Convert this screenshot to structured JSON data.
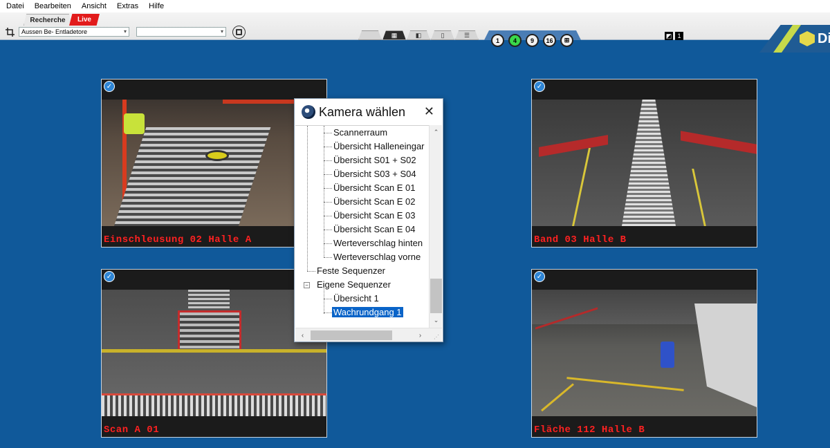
{
  "menu": [
    "Datei",
    "Bearbeiten",
    "Ansicht",
    "Extras",
    "Hilfe"
  ],
  "mode_tabs": {
    "recherche": "Recherche",
    "live": "Live"
  },
  "toolbar": {
    "location_select": "Aussen Be- Entladetore",
    "second_select": "",
    "status_values": [
      "",
      "1"
    ]
  },
  "layout_buttons": [
    {
      "label": "1",
      "active": false
    },
    {
      "label": "4",
      "active": true
    },
    {
      "label": "9",
      "active": false
    },
    {
      "label": "16",
      "active": false
    },
    {
      "label": "⊞",
      "active": false
    }
  ],
  "logo_text": "Di",
  "cameras": [
    {
      "label": "Einschleusung 02 Halle A"
    },
    {
      "label": "Band 03 Halle B"
    },
    {
      "label": "Scan A 01"
    },
    {
      "label": "Fläche 112 Halle B"
    }
  ],
  "dialog": {
    "title": "Kamera wählen",
    "items": [
      "Scannerraum",
      "Übersicht Halleneingar",
      "Übersicht S01 + S02",
      "Übersicht S03 + S04",
      "Übersicht Scan E 01",
      "Übersicht Scan E 02",
      "Übersicht Scan E 03",
      "Übersicht Scan E 04",
      "Werteverschlag hinten",
      "Werteverschlag vorne"
    ],
    "groups": {
      "feste": "Feste Sequenzer",
      "eigene": "Eigene Sequenzer"
    },
    "sub_items": [
      "Übersicht 1",
      "Wachrundgang 1"
    ],
    "selected": "Wachrundgang 1"
  }
}
